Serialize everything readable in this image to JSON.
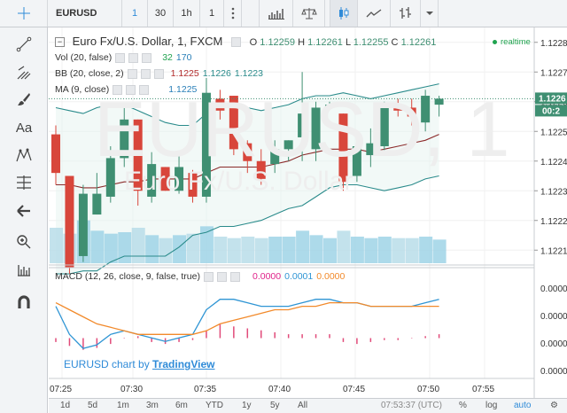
{
  "toolbar": {
    "symbol": "EURUSD",
    "intervals": [
      "1",
      "30",
      "1h",
      "1"
    ],
    "active_interval_index": 0,
    "icons": [
      "crosshair-icon",
      "more-vert-icon",
      "bar-chart-icon",
      "scale-icon",
      "candles-icon",
      "line-chart-icon",
      "ohlc-bars-icon",
      "chevron-down-icon"
    ]
  },
  "left_tools": [
    "crosshair-icon",
    "trend-line-icon",
    "fork-icon",
    "brush-icon",
    "text-icon",
    "pattern-icon",
    "fib-icon",
    "arrow-left-icon",
    "zoom-icon",
    "measure-icon",
    "magnet-icon"
  ],
  "legend": {
    "title": "Euro Fx/U.S. Dollar, 1, FXCM",
    "o_label": "O",
    "o": "1.12259",
    "h_label": "H",
    "h": "1.12261",
    "l_label": "L",
    "l": "1.12255",
    "c_label": "C",
    "c": "1.12261",
    "realtime": "realtime",
    "vol_label": "Vol (20, false)",
    "vol_1": "32",
    "vol_2": "170",
    "bb_label": "BB (20, close, 2)",
    "bb_1": "1.1225",
    "bb_2": "1.1226",
    "bb_3": "1.1223",
    "ma_label": "MA (9, close)",
    "ma_1": "1.1225",
    "macd_label": "MACD (12, 26, close, 9, false, true)",
    "macd_1": "0.0000",
    "macd_2": "0.0001",
    "macd_3": "0.0000"
  },
  "watermark": {
    "big": "EURUSD, 1",
    "small": "Euro Fx/U.S. Dollar"
  },
  "brand": {
    "prefix": "EURUSD chart by ",
    "link": "TradingView"
  },
  "price_axis": {
    "ticks": [
      "1.1228",
      "1.1227",
      "1.1226",
      "1.1225",
      "1.1224",
      "1.1223",
      "1.1222",
      "1.1221"
    ],
    "last_price": "1.1226",
    "countdown": "00:2"
  },
  "macd_axis": {
    "ticks": [
      "0.0000",
      "0.0000",
      "0.0000",
      "0.0000"
    ]
  },
  "time_axis": [
    "07:25",
    "07:30",
    "07:35",
    "07:40",
    "07:45",
    "07:50",
    "07:55"
  ],
  "bottom_bar": {
    "ranges": [
      "1d",
      "5d",
      "1m",
      "3m",
      "6m",
      "YTD",
      "1y",
      "5y",
      "All"
    ],
    "clock": "07:53:37 (UTC)",
    "percent": "%",
    "log": "log",
    "auto": "auto"
  },
  "colors": {
    "up": "#3f8f72",
    "down": "#d8463b",
    "accent": "#2f8bd8",
    "macd_line": "#2f95d4",
    "signal_line": "#f28a2b",
    "hist": "#e14b7a"
  },
  "chart_data": {
    "type": "candlestick",
    "ylim": [
      1.12205,
      1.12285
    ],
    "candles": [
      {
        "o": 1.12249,
        "h": 1.12252,
        "l": 1.12232,
        "c": 1.12236
      },
      {
        "o": 1.12235,
        "h": 1.12233,
        "l": 1.12202,
        "c": 1.12204
      },
      {
        "o": 1.12208,
        "h": 1.12232,
        "l": 1.12206,
        "c": 1.12229
      },
      {
        "o": 1.12222,
        "h": 1.12236,
        "l": 1.12222,
        "c": 1.12229
      },
      {
        "o": 1.12228,
        "h": 1.12245,
        "l": 1.12226,
        "c": 1.12241
      },
      {
        "o": 1.12241,
        "h": 1.12258,
        "l": 1.12238,
        "c": 1.12254
      },
      {
        "o": 1.12254,
        "h": 1.12254,
        "l": 1.12225,
        "c": 1.1223
      },
      {
        "o": 1.12228,
        "h": 1.12243,
        "l": 1.12226,
        "c": 1.12239
      },
      {
        "o": 1.12238,
        "h": 1.12238,
        "l": 1.1223,
        "c": 1.1223
      },
      {
        "o": 1.1223,
        "h": 1.12242,
        "l": 1.12229,
        "c": 1.12238
      },
      {
        "o": 1.12236,
        "h": 1.12237,
        "l": 1.12226,
        "c": 1.12228
      },
      {
        "o": 1.12228,
        "h": 1.12268,
        "l": 1.12226,
        "c": 1.12263
      },
      {
        "o": 1.12261,
        "h": 1.12264,
        "l": 1.12254,
        "c": 1.12257
      },
      {
        "o": 1.12262,
        "h": 1.12262,
        "l": 1.12242,
        "c": 1.12244
      },
      {
        "o": 1.12246,
        "h": 1.12247,
        "l": 1.12236,
        "c": 1.1224
      },
      {
        "o": 1.1224,
        "h": 1.12244,
        "l": 1.12232,
        "c": 1.12234
      },
      {
        "o": 1.12239,
        "h": 1.12247,
        "l": 1.12236,
        "c": 1.12244
      },
      {
        "o": 1.12244,
        "h": 1.12247,
        "l": 1.1224,
        "c": 1.12247
      },
      {
        "o": 1.12248,
        "h": 1.1227,
        "l": 1.1224,
        "c": 1.12256
      },
      {
        "o": 1.12244,
        "h": 1.1226,
        "l": 1.1224,
        "c": 1.12258
      },
      {
        "o": 1.12258,
        "h": 1.1226,
        "l": 1.12258,
        "c": 1.12259
      },
      {
        "o": 1.12256,
        "h": 1.12256,
        "l": 1.1223,
        "c": 1.12233
      },
      {
        "o": 1.12235,
        "h": 1.12246,
        "l": 1.12233,
        "c": 1.12245
      },
      {
        "o": 1.12242,
        "h": 1.12251,
        "l": 1.12238,
        "c": 1.12246
      },
      {
        "o": 1.12245,
        "h": 1.1226,
        "l": 1.12243,
        "c": 1.12258
      },
      {
        "o": 1.12259,
        "h": 1.12261,
        "l": 1.12255,
        "c": 1.12257
      },
      {
        "o": 1.12258,
        "h": 1.12261,
        "l": 1.12252,
        "c": 1.12255
      },
      {
        "o": 1.12253,
        "h": 1.12264,
        "l": 1.1225,
        "c": 1.12262
      },
      {
        "o": 1.12259,
        "h": 1.12262,
        "l": 1.12255,
        "c": 1.12261
      }
    ],
    "volumes": [
      48,
      40,
      58,
      44,
      40,
      42,
      48,
      38,
      34,
      38,
      40,
      50,
      36,
      34,
      36,
      34,
      36,
      36,
      44,
      38,
      34,
      44,
      36,
      34,
      36,
      34,
      34,
      36,
      32
    ],
    "bb_upper": [
      1.12258,
      1.12257,
      1.12256,
      1.12258,
      1.12259,
      1.12259,
      1.12257,
      1.12255,
      1.12253,
      1.12252,
      1.12252,
      1.12256,
      1.12258,
      1.12258,
      1.12258,
      1.12257,
      1.12258,
      1.12259,
      1.12261,
      1.12262,
      1.12262,
      1.12263,
      1.12262,
      1.12261,
      1.12262,
      1.12263,
      1.12264,
      1.12265,
      1.12266
    ],
    "bb_lower": [
      1.12202,
      1.12202,
      1.12203,
      1.12203,
      1.12206,
      1.12208,
      1.12208,
      1.12208,
      1.12208,
      1.12211,
      1.12215,
      1.12216,
      1.12218,
      1.12218,
      1.12219,
      1.1222,
      1.12222,
      1.12224,
      1.12225,
      1.12228,
      1.12231,
      1.12232,
      1.12232,
      1.12231,
      1.1223,
      1.12231,
      1.12232,
      1.12234,
      1.12235
    ],
    "ma": [
      1.12232,
      1.12232,
      1.12231,
      1.12231,
      1.12232,
      1.12233,
      1.12233,
      1.12234,
      1.12234,
      1.12234,
      1.12234,
      1.12236,
      1.12238,
      1.12238,
      1.12238,
      1.12238,
      1.12239,
      1.1224,
      1.12242,
      1.12243,
      1.12244,
      1.12244,
      1.12244,
      1.12243,
      1.12244,
      1.12245,
      1.12246,
      1.12247,
      1.12249
    ],
    "macd": [
      0.2,
      -0.6,
      -1.0,
      -0.9,
      -0.6,
      -0.5,
      -0.6,
      -0.7,
      -0.8,
      -0.7,
      -0.6,
      0.1,
      0.4,
      0.4,
      0.3,
      0.2,
      0.2,
      0.2,
      0.3,
      0.4,
      0.4,
      0.3,
      0.3,
      0.2,
      0.2,
      0.2,
      0.2,
      0.3,
      0.4
    ],
    "signal": [
      0.3,
      0.1,
      -0.1,
      -0.3,
      -0.4,
      -0.5,
      -0.6,
      -0.6,
      -0.6,
      -0.6,
      -0.6,
      -0.5,
      -0.3,
      -0.2,
      -0.1,
      0.0,
      0.1,
      0.1,
      0.2,
      0.2,
      0.3,
      0.3,
      0.3,
      0.2,
      0.2,
      0.2,
      0.2,
      0.2,
      0.2
    ],
    "histogram": [
      -0.2,
      -0.4,
      -0.6,
      -0.5,
      -0.3,
      0.0,
      0.1,
      -0.2,
      -0.3,
      -0.2,
      -0.1,
      0.4,
      0.7,
      0.6,
      0.5,
      0.4,
      0.3,
      0.2,
      0.2,
      0.2,
      0.2,
      -0.2,
      -0.3,
      -0.2,
      -0.1,
      -0.1,
      0.0,
      0.1,
      0.2
    ]
  }
}
